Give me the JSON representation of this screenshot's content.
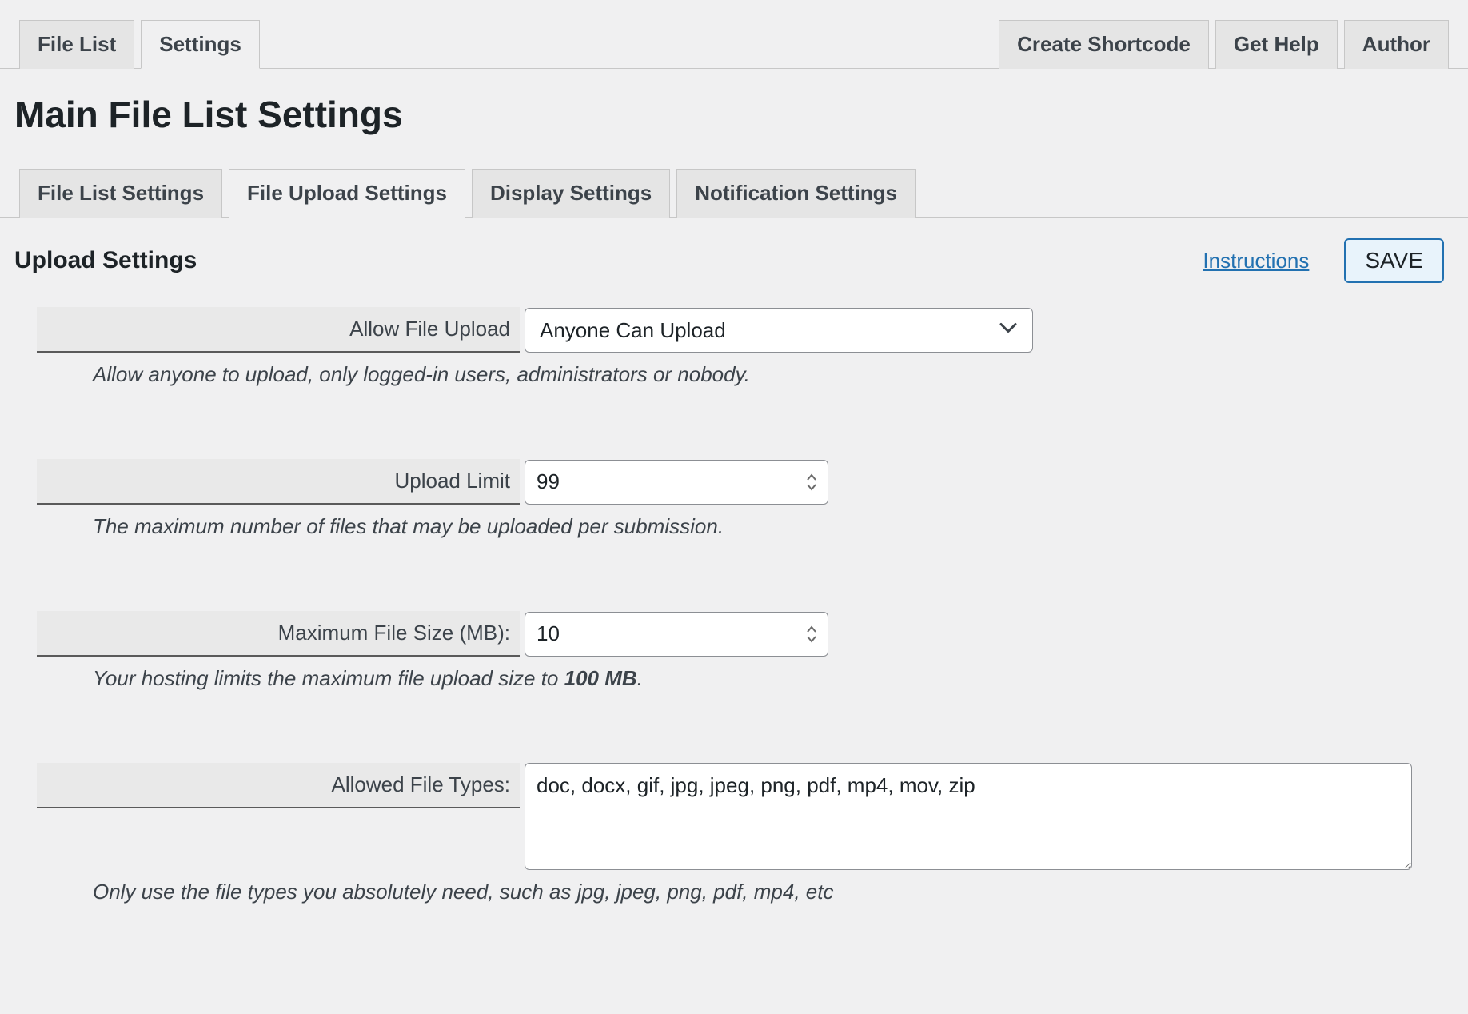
{
  "topTabs": {
    "left": [
      {
        "label": "File List",
        "active": false
      },
      {
        "label": "Settings",
        "active": true
      }
    ],
    "right": [
      {
        "label": "Create Shortcode"
      },
      {
        "label": "Get Help"
      },
      {
        "label": "Author"
      }
    ]
  },
  "pageTitle": "Main File List Settings",
  "subTabs": [
    {
      "label": "File List Settings",
      "active": false
    },
    {
      "label": "File Upload Settings",
      "active": true
    },
    {
      "label": "Display Settings",
      "active": false
    },
    {
      "label": "Notification Settings",
      "active": false
    }
  ],
  "section": {
    "title": "Upload Settings",
    "instructionsLabel": "Instructions",
    "saveLabel": "SAVE"
  },
  "fields": {
    "allowUpload": {
      "label": "Allow File Upload",
      "value": "Anyone Can Upload",
      "desc": "Allow anyone to upload, only logged-in users, administrators or nobody."
    },
    "uploadLimit": {
      "label": "Upload Limit",
      "value": "99",
      "desc": "The maximum number of files that may be uploaded per submission."
    },
    "maxFileSize": {
      "label": "Maximum File Size (MB):",
      "value": "10",
      "descPrefix": "Your hosting limits the maximum file upload size to ",
      "descBold": "100 MB",
      "descSuffix": "."
    },
    "allowedTypes": {
      "label": "Allowed File Types:",
      "value": "doc, docx, gif, jpg, jpeg, png, pdf, mp4, mov, zip",
      "desc": "Only use the file types you absolutely need, such as jpg, jpeg, png, pdf, mp4, etc"
    }
  }
}
